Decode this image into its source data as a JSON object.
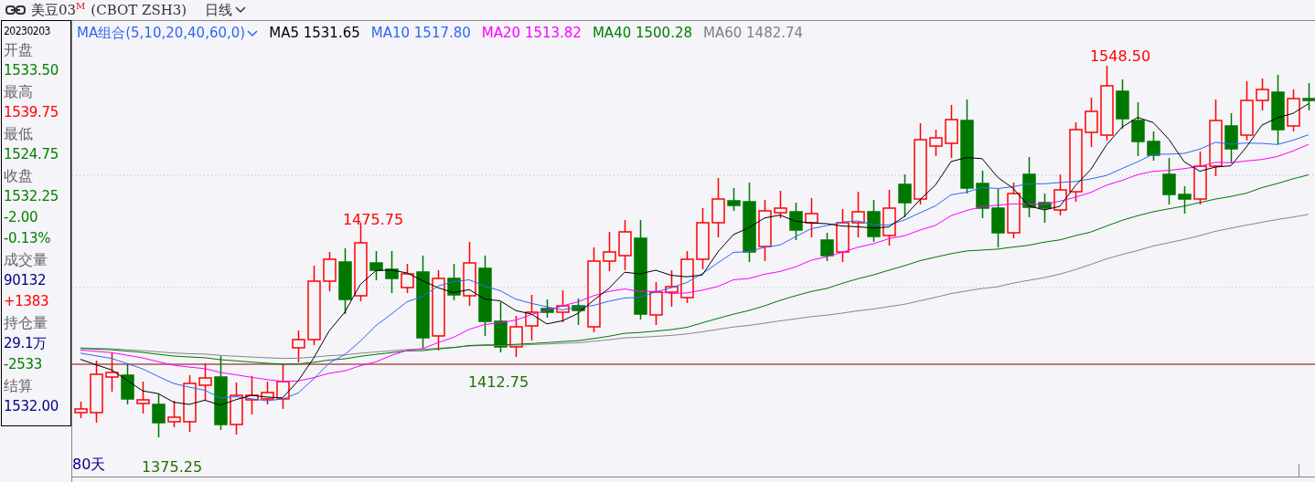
{
  "header": {
    "symbol": "美豆03",
    "superscript": "M",
    "code": "(CBOT  ZSH3)",
    "period": "日线"
  },
  "info_panel": {
    "date": "20230203",
    "items": [
      {
        "kind": "label",
        "text": "开盘"
      },
      {
        "kind": "value",
        "text": "1533.50",
        "color": "#008000"
      },
      {
        "kind": "label",
        "text": "最高"
      },
      {
        "kind": "value",
        "text": "1539.75",
        "color": "#ff0000"
      },
      {
        "kind": "label",
        "text": "最低"
      },
      {
        "kind": "value",
        "text": "1524.75",
        "color": "#008000"
      },
      {
        "kind": "label",
        "text": "收盘"
      },
      {
        "kind": "value",
        "text": "1532.25",
        "color": "#008000"
      },
      {
        "kind": "value",
        "text": "-2.00",
        "color": "#008000"
      },
      {
        "kind": "value",
        "text": "-0.13%",
        "color": "#008000"
      },
      {
        "kind": "label",
        "text": "成交量"
      },
      {
        "kind": "value",
        "text": "90132",
        "color": "#000080"
      },
      {
        "kind": "value",
        "text": "+1383",
        "color": "#ff0000"
      },
      {
        "kind": "label",
        "text": "持仓量"
      },
      {
        "kind": "value",
        "text": "29.1万",
        "color": "#000080"
      },
      {
        "kind": "value",
        "text": "-2533",
        "color": "#008000"
      },
      {
        "kind": "label",
        "text": "结算"
      },
      {
        "kind": "value",
        "text": "1532.00",
        "color": "#000080"
      }
    ]
  },
  "indicator": {
    "name": "MA组合(5,10,20,40,60,0)",
    "values": [
      {
        "label": "MA5",
        "value": "1531.65",
        "color": "#000000"
      },
      {
        "label": "MA10",
        "value": "1517.80",
        "color": "#3366ee"
      },
      {
        "label": "MA20",
        "value": "1513.82",
        "color": "#ff00ff"
      },
      {
        "label": "MA40",
        "value": "1500.28",
        "color": "#008000"
      },
      {
        "label": "MA60",
        "value": "1482.74",
        "color": "#808080"
      }
    ]
  },
  "chart": {
    "annotations": [
      {
        "kind": "high",
        "text": "1548.50"
      },
      {
        "kind": "high",
        "text": "1475.75"
      },
      {
        "kind": "low",
        "text": "1412.75"
      },
      {
        "kind": "low",
        "text": "1375.25"
      }
    ],
    "span": "80天"
  }
}
